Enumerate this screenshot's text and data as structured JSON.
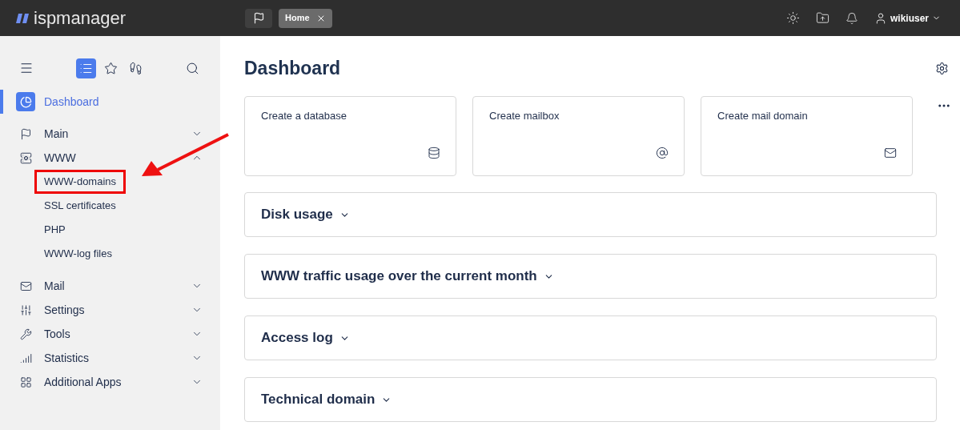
{
  "header": {
    "logo": "ispmanager",
    "tabs": [
      {
        "label": "Home",
        "selected": true
      }
    ],
    "user": "wikiuser"
  },
  "sidebar": {
    "modes": [
      {
        "selected": true
      },
      {
        "selected": false
      },
      {
        "selected": false
      }
    ],
    "items": [
      {
        "label": "Dashboard",
        "selected": true
      },
      {
        "label": "Main",
        "selected": false,
        "expanded": false
      },
      {
        "label": "WWW",
        "selected": false,
        "expanded": true,
        "children": [
          {
            "label": "WWW-domains",
            "highlighted": true
          },
          {
            "label": "SSL certificates",
            "highlighted": false
          },
          {
            "label": "PHP",
            "highlighted": false
          },
          {
            "label": "WWW-log files",
            "highlighted": false
          }
        ]
      },
      {
        "label": "Mail",
        "selected": false,
        "expanded": false
      },
      {
        "label": "Settings",
        "selected": false,
        "expanded": false
      },
      {
        "label": "Tools",
        "selected": false,
        "expanded": false
      },
      {
        "label": "Statistics",
        "selected": false,
        "expanded": false
      },
      {
        "label": "Additional Apps",
        "selected": false,
        "expanded": false
      }
    ]
  },
  "main": {
    "title": "Dashboard",
    "quick_actions": [
      {
        "label": "Create a database"
      },
      {
        "label": "Create mailbox"
      },
      {
        "label": "Create mail domain"
      }
    ],
    "panels": [
      {
        "title": "Disk usage",
        "expanded": false
      },
      {
        "title": "WWW traffic usage over the current month",
        "expanded": false
      },
      {
        "title": "Access log",
        "expanded": false
      },
      {
        "title": "Technical domain",
        "expanded": false
      }
    ]
  }
}
